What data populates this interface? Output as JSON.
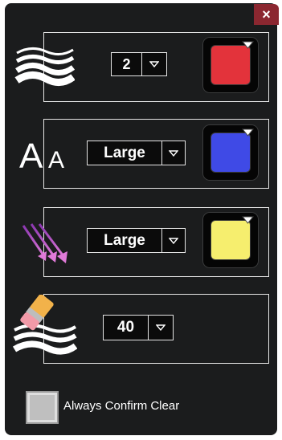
{
  "window": {
    "close_label": "×"
  },
  "line_width": {
    "icon": "waves-icon",
    "value": "2",
    "color": "#e3333b"
  },
  "text_size": {
    "icon": "font-size-icon",
    "icon_text": "A",
    "value": "Large",
    "color": "#3f4ae6"
  },
  "arrow_size": {
    "icon": "arrows-icon",
    "value": "Large",
    "color": "#f6ee6e"
  },
  "eraser_size": {
    "icon": "eraser-icon",
    "value": "40"
  },
  "confirm_clear": {
    "label": "Always Confirm Clear",
    "checked": false
  }
}
